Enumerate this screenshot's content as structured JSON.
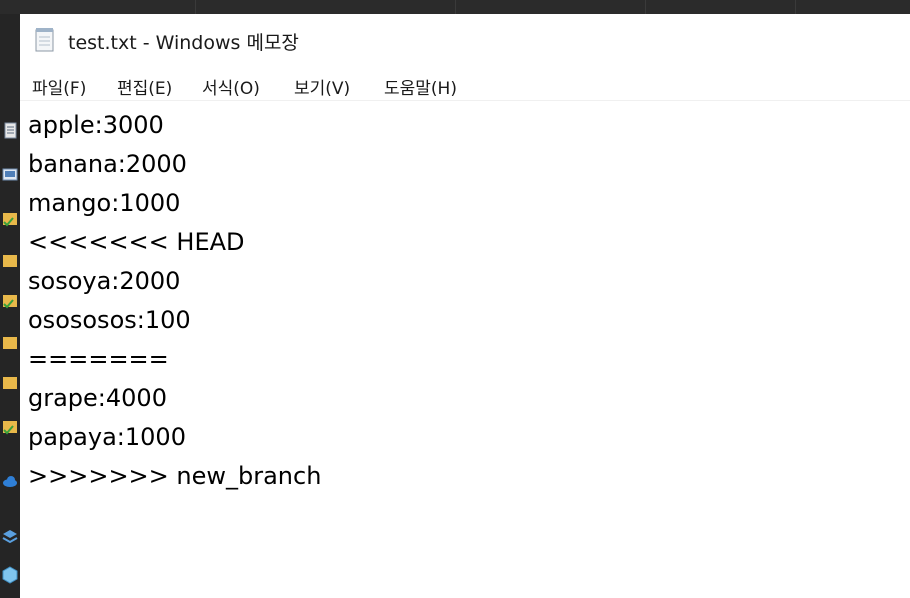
{
  "window": {
    "title": "test.txt - Windows 메모장",
    "icon": "notepad-icon"
  },
  "menu": {
    "items": [
      {
        "label": "파일(F)"
      },
      {
        "label": "편집(E)"
      },
      {
        "label": "서식(O)"
      },
      {
        "label": "보기(V)"
      },
      {
        "label": "도움말(H)"
      }
    ]
  },
  "editor": {
    "lines": [
      "apple:3000",
      "banana:2000",
      "mango:1000",
      "<<<<<<< HEAD",
      "sosoya:2000",
      "osososos:100",
      "=======",
      "grape:4000",
      "papaya:1000",
      ">>>>>>> new_branch"
    ]
  },
  "taskbar_left": {
    "icons": [
      "document-icon",
      "image-icon",
      "folder-check-icon",
      "folder-icon",
      "folder-check-icon",
      "folder-icon",
      "folder-icon",
      "folder-check-icon",
      "cloud-icon",
      "stack-icon",
      "cube-icon"
    ]
  }
}
